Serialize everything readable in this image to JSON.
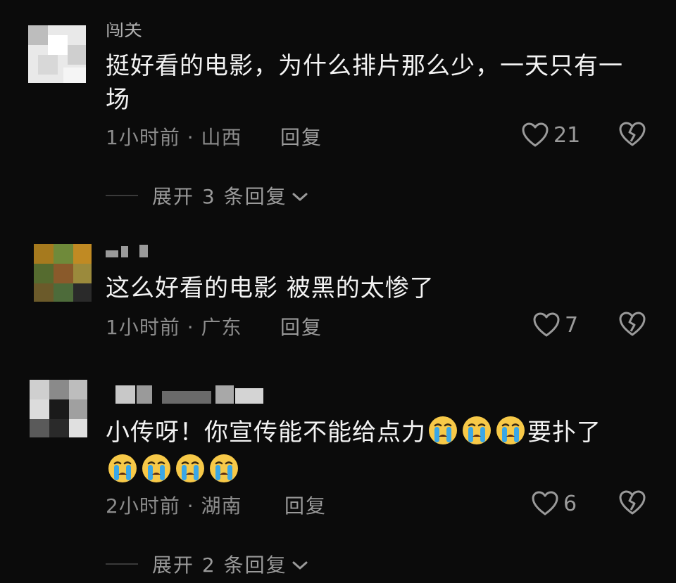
{
  "comments": [
    {
      "username": "闯关",
      "text": "挺好看的电影，为什么排片那么少，一天只有一场",
      "time_location": "1小时前 · 山西",
      "reply_label": "回复",
      "likes": "21",
      "expand_label": "展开 3 条回复"
    },
    {
      "username": "",
      "text": "这么好看的电影 被黑的太惨了",
      "time_location": "1小时前 · 广东",
      "reply_label": "回复",
      "likes": "7"
    },
    {
      "username": "",
      "text_before_emoji": "小传呀！你宣传能不能给点力",
      "text_after_emoji": "要扑了",
      "emoji_name": "crying-face",
      "time_location": "2小时前 · 湖南",
      "reply_label": "回复",
      "likes": "6",
      "expand_label": "展开 2 条回复"
    }
  ],
  "colors": {
    "background": "#0b0b0b",
    "text": "#f3f3f3",
    "meta": "#8c8c8c",
    "emoji_face": "#f7c948",
    "emoji_tear": "#3aa7e6"
  }
}
